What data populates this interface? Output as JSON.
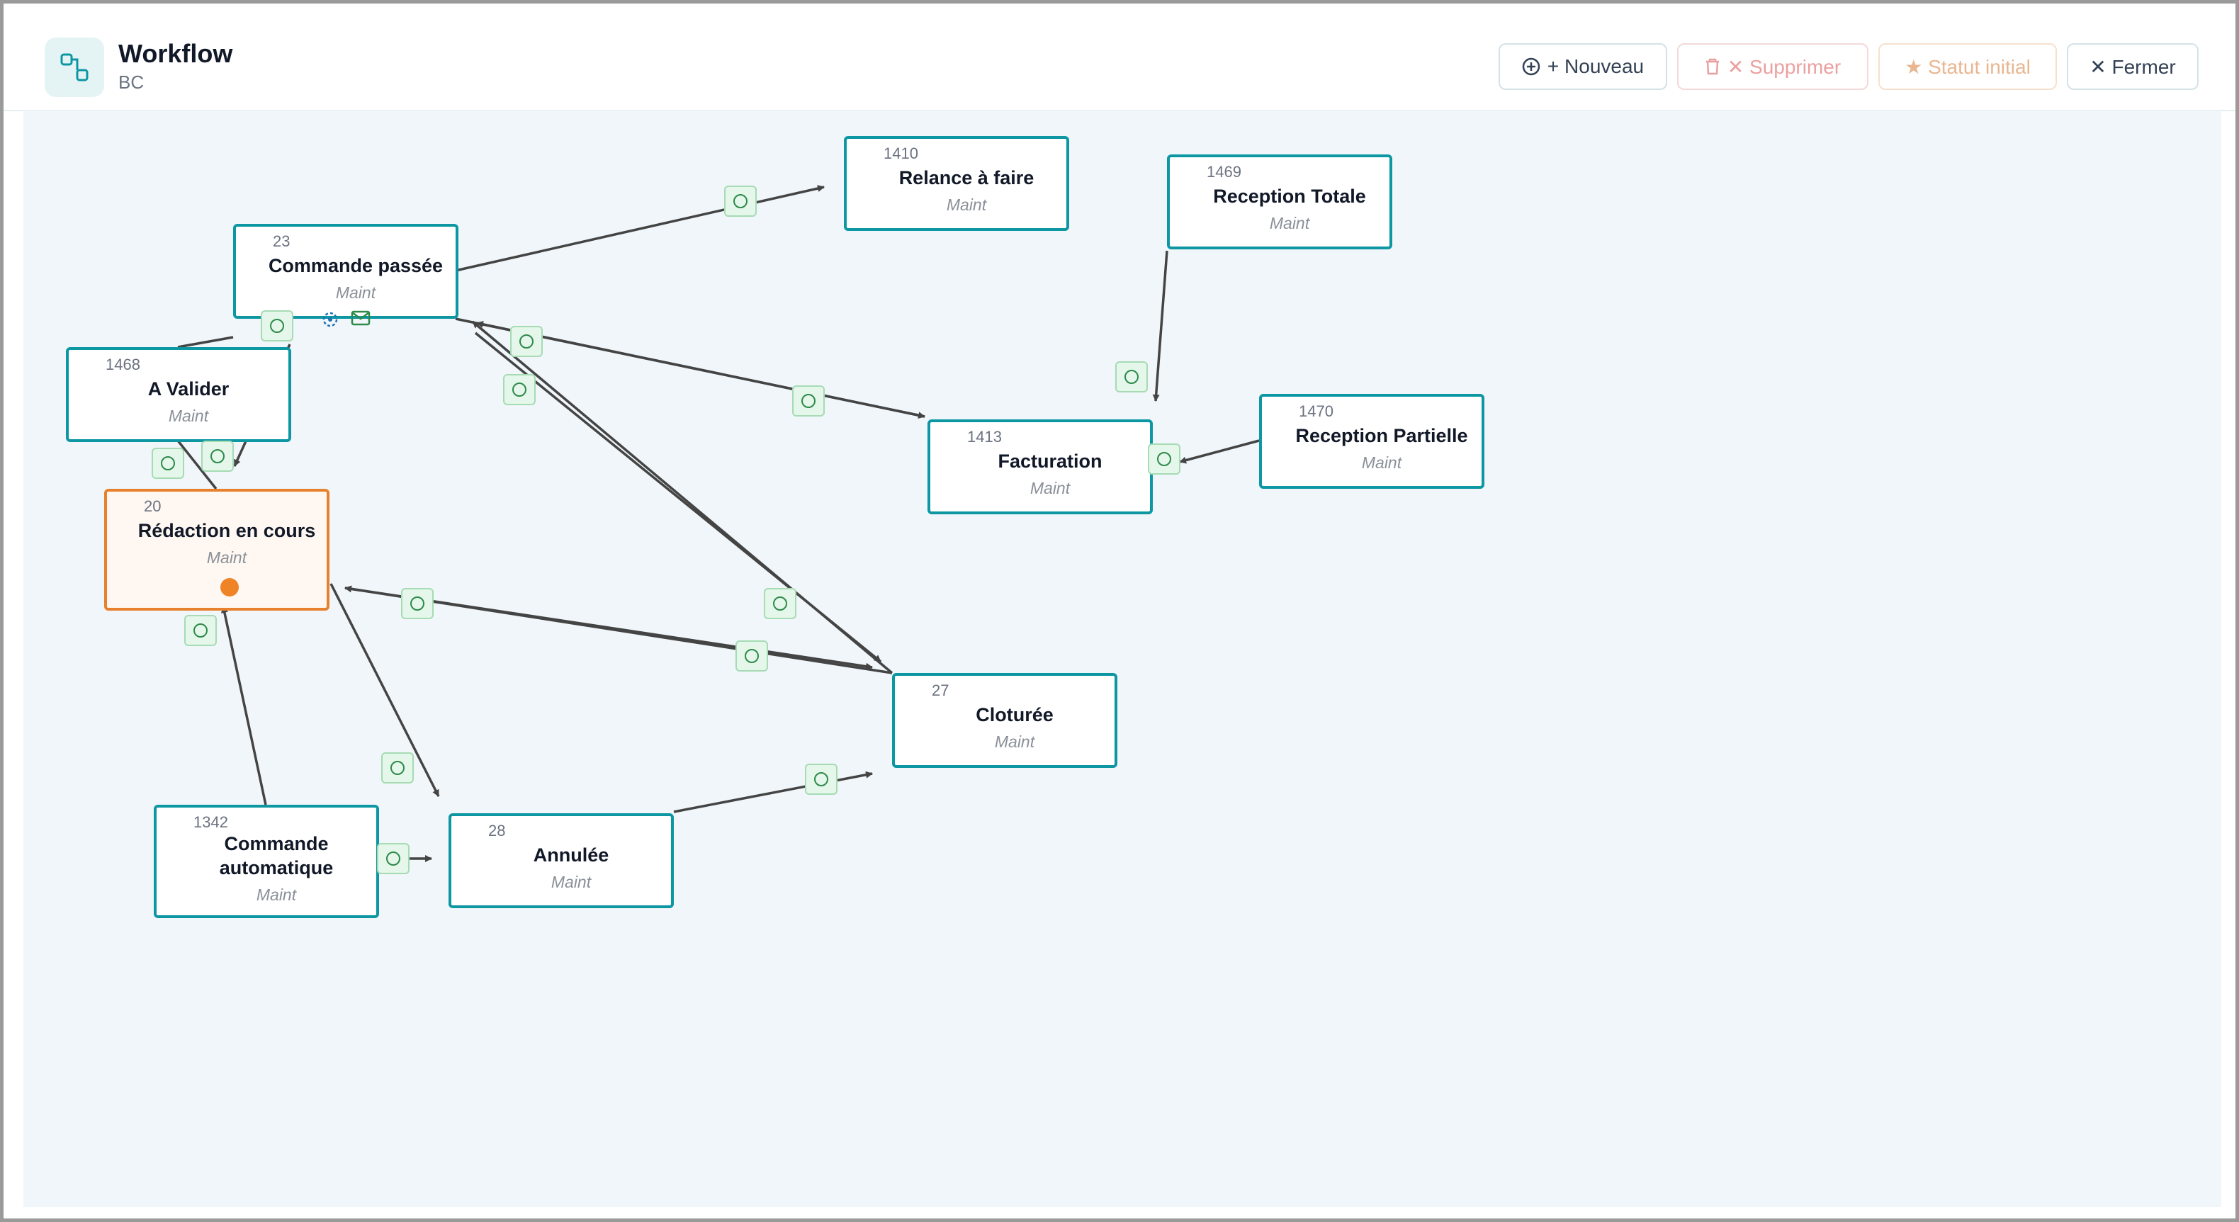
{
  "header": {
    "title": "Workflow",
    "subtitle": "BC",
    "buttons": {
      "new": "+ Nouveau",
      "delete": "✕ Supprimer",
      "initial": "★ Statut initial",
      "close": "✕ Fermer"
    }
  },
  "nodes": [
    {
      "key": "n1410",
      "id": "1410",
      "name": "Relance à faire",
      "sub": "Maint"
    },
    {
      "key": "n1469",
      "id": "1469",
      "name": "Reception Totale",
      "sub": "Maint"
    },
    {
      "key": "n23",
      "id": "23",
      "name": "Commande passée",
      "sub": "Maint"
    },
    {
      "key": "n1468",
      "id": "1468",
      "name": "A Valider",
      "sub": "Maint"
    },
    {
      "key": "n1413",
      "id": "1413",
      "name": "Facturation",
      "sub": "Maint"
    },
    {
      "key": "n1470",
      "id": "1470",
      "name": "Reception Partielle",
      "sub": "Maint"
    },
    {
      "key": "n20",
      "id": "20",
      "name": "Rédaction en cours",
      "sub": "Maint"
    },
    {
      "key": "n27",
      "id": "27",
      "name": "Cloturée",
      "sub": "Maint"
    },
    {
      "key": "n1342",
      "id": "1342",
      "name": "Commande automatique",
      "sub": "Maint"
    },
    {
      "key": "n28",
      "id": "28",
      "name": "Annulée",
      "sub": "Maint"
    }
  ],
  "colors": {
    "node_border": "#0d97a3",
    "initial_border": "#e8812d",
    "initial_dot": "#ee8426",
    "transition_fill": "#e5f7ea",
    "edge": "#444444",
    "canvas_bg": "#f0f6f9"
  },
  "icons": {
    "logo": "workflow-icon",
    "new": "plus-circle-icon",
    "delete": "trash-icon",
    "close": "close-icon",
    "node_actions": [
      "gear-icon",
      "mail-icon"
    ],
    "transition": "circle-icon"
  }
}
